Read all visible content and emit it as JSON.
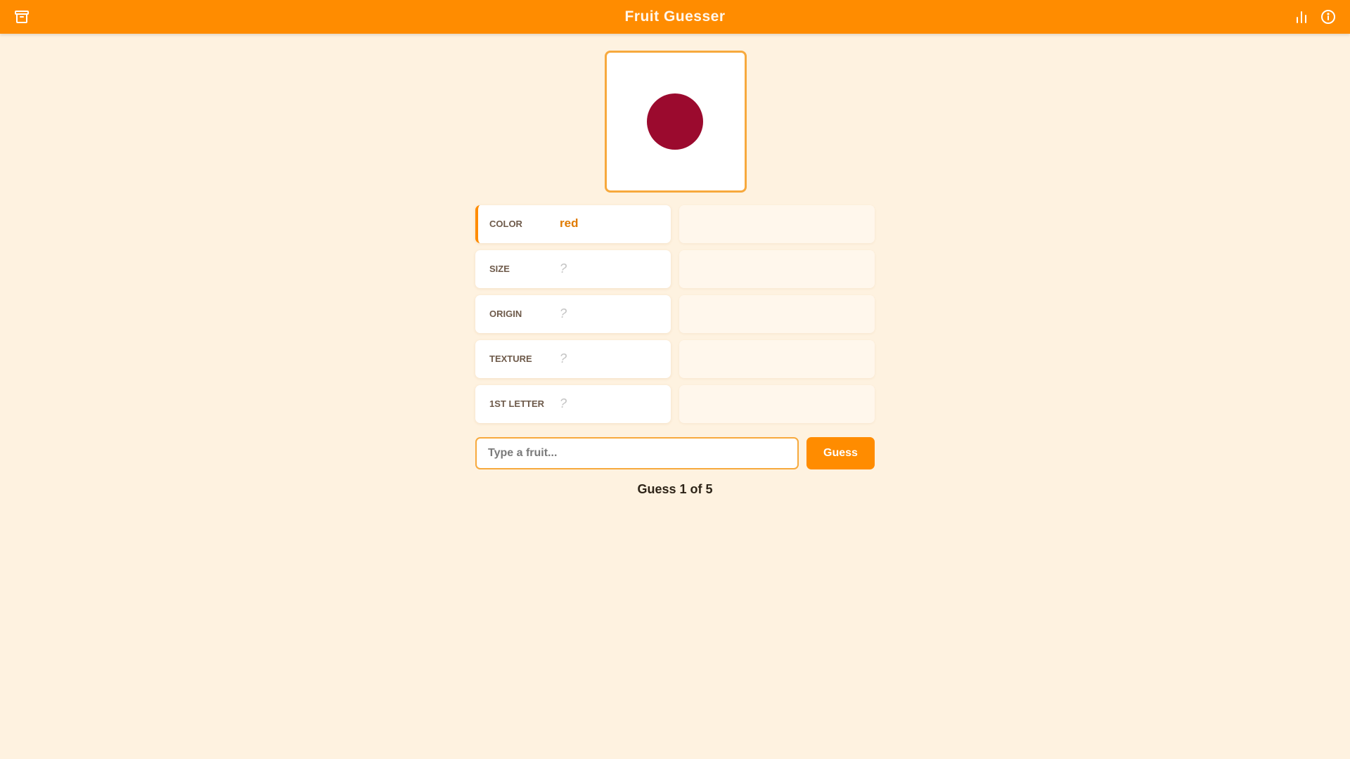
{
  "app": {
    "title": "Fruit Guesser",
    "accent_color": "#ff8c00",
    "icons": {
      "left": "archive-icon",
      "right": [
        "bar-chart-icon",
        "info-icon"
      ]
    }
  },
  "fruit_preview": {
    "color": "#9b0a2e"
  },
  "hints": [
    {
      "label": "COLOR",
      "value": "red",
      "revealed": true
    },
    {
      "label": "SIZE",
      "value": "?",
      "revealed": false
    },
    {
      "label": "ORIGIN",
      "value": "?",
      "revealed": false
    },
    {
      "label": "TEXTURE",
      "value": "?",
      "revealed": false
    },
    {
      "label": "1ST LETTER",
      "value": "?",
      "revealed": false
    }
  ],
  "guess_form": {
    "placeholder": "Type a fruit...",
    "value": "",
    "button_label": "Guess"
  },
  "status": {
    "counter_text": "Guess 1 of 5"
  }
}
